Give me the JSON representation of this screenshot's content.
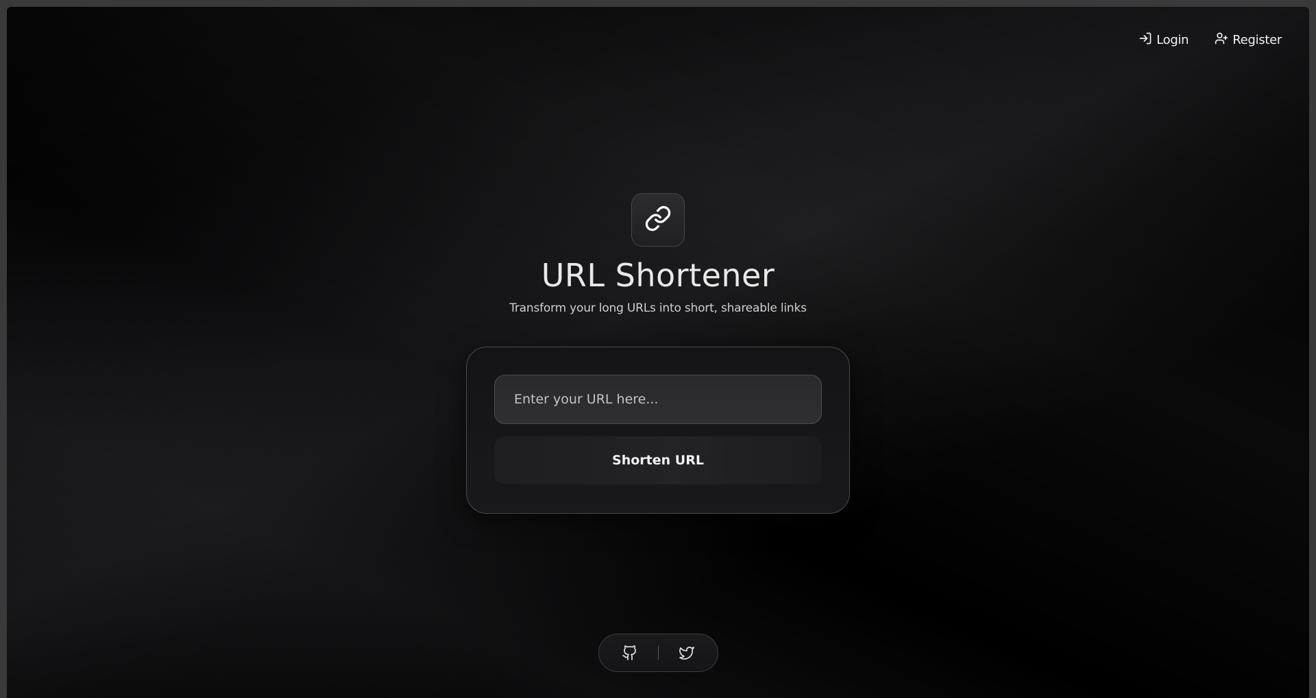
{
  "nav": {
    "login_label": "Login",
    "register_label": "Register"
  },
  "hero": {
    "icon": "link-icon",
    "title": "URL Shortener",
    "subtitle": "Transform your long URLs into short, shareable links"
  },
  "form": {
    "url_input": {
      "value": "",
      "placeholder": "Enter your URL here..."
    },
    "submit_label": "Shorten URL"
  },
  "footer": {
    "icons": [
      "github-icon",
      "twitter-icon"
    ]
  },
  "colors": {
    "background": "#000000",
    "card_border": "#4a4a4e",
    "text_primary": "#e9e9ea"
  }
}
